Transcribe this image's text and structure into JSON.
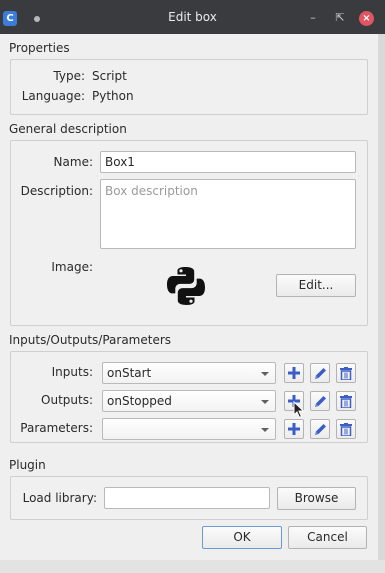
{
  "window": {
    "title": "Edit box",
    "app_icon_letter": "C"
  },
  "properties": {
    "section": "Properties",
    "type_label": "Type:",
    "type_value": "Script",
    "language_label": "Language:",
    "language_value": "Python"
  },
  "general": {
    "section": "General description",
    "name_label": "Name:",
    "name_value": "Box1",
    "description_label": "Description:",
    "description_placeholder": "Box description",
    "image_label": "Image:",
    "edit_button": "Edit..."
  },
  "io": {
    "section": "Inputs/Outputs/Parameters",
    "inputs_label": "Inputs:",
    "inputs_value": "onStart",
    "outputs_label": "Outputs:",
    "outputs_value": "onStopped",
    "parameters_label": "Parameters:",
    "parameters_value": ""
  },
  "plugin": {
    "section": "Plugin",
    "load_library_label": "Load library:",
    "load_library_value": "",
    "browse_button": "Browse"
  },
  "footer": {
    "ok_button": "OK",
    "cancel_button": "Cancel"
  },
  "icons": {
    "add": "plus-icon",
    "edit": "pencil-icon",
    "delete": "trash-icon",
    "image": "python-logo-icon",
    "title_close": "close-icon"
  },
  "colors": {
    "accent": "#3b7dd8",
    "close": "#e05561",
    "titlebar": "#3a3b3f"
  }
}
